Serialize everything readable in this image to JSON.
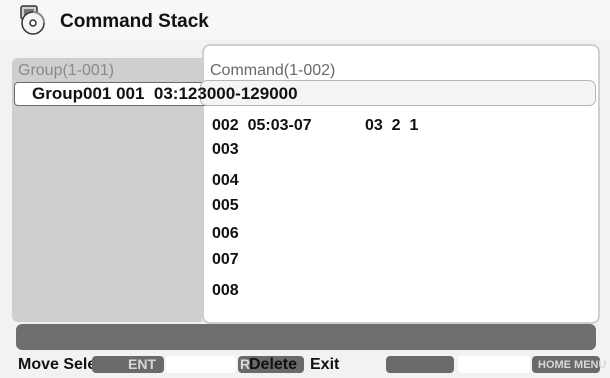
{
  "app": {
    "title": "Command Stack",
    "icon": "disc-folder-icon"
  },
  "group": {
    "header": "Group(1-001)",
    "selected_row": "Group001 001  03:123000-129000"
  },
  "command": {
    "header": "Command(1-002)",
    "items": [
      {
        "text": "002  05:03-07            03  2  1"
      },
      {
        "text": "003"
      },
      {
        "text": "004"
      },
      {
        "text": "005"
      },
      {
        "text": "006"
      },
      {
        "text": "007"
      },
      {
        "text": "008"
      }
    ]
  },
  "footer": {
    "move_select": "Move Select",
    "enter_key": "ENT",
    "delete_key": "R",
    "delete_label": "Delete",
    "exit_label": "Exit",
    "home_menu_key": "HOME MENU"
  },
  "colors": {
    "panel_gray": "#cfcfcf",
    "status_bar": "#6e6e6e",
    "key_dark": "#6a6a6a"
  }
}
